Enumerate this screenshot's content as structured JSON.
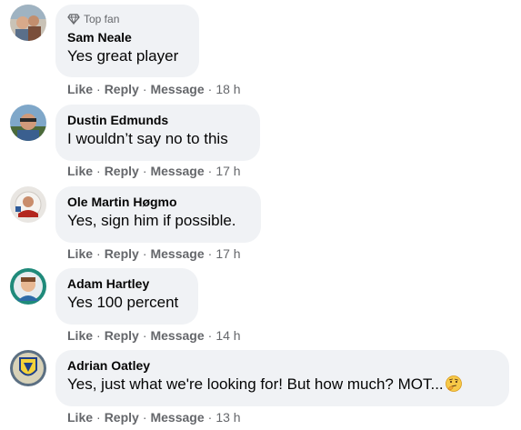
{
  "comments": [
    {
      "badge": "Top fan",
      "name": "Sam Neale",
      "text": "Yes great player",
      "like": "Like",
      "reply": "Reply",
      "message": "Message",
      "time": "18 h",
      "avatar_icon": "profile-photo"
    },
    {
      "name": "Dustin Edmunds",
      "text": "I wouldn’t say no to this",
      "like": "Like",
      "reply": "Reply",
      "message": "Message",
      "time": "17 h",
      "avatar_icon": "profile-photo"
    },
    {
      "name": "Ole Martin Høgmo",
      "text": "Yes, sign him if possible.",
      "like": "Like",
      "reply": "Reply",
      "message": "Message",
      "time": "17 h",
      "avatar_icon": "profile-photo"
    },
    {
      "name": "Adam Hartley",
      "text": "Yes 100 percent",
      "like": "Like",
      "reply": "Reply",
      "message": "Message",
      "time": "14 h",
      "avatar_icon": "profile-photo"
    },
    {
      "name": "Adrian Oatley",
      "text": "Yes, just what we're looking for! But how much? MOT...",
      "emoji": "thinking-face",
      "like": "Like",
      "reply": "Reply",
      "message": "Message",
      "time": "13 h",
      "avatar_icon": "profile-photo"
    }
  ],
  "separator": "·",
  "colors": {
    "bubble": "#f0f2f5",
    "meta_text": "#65676b",
    "primary_text": "#050505"
  }
}
